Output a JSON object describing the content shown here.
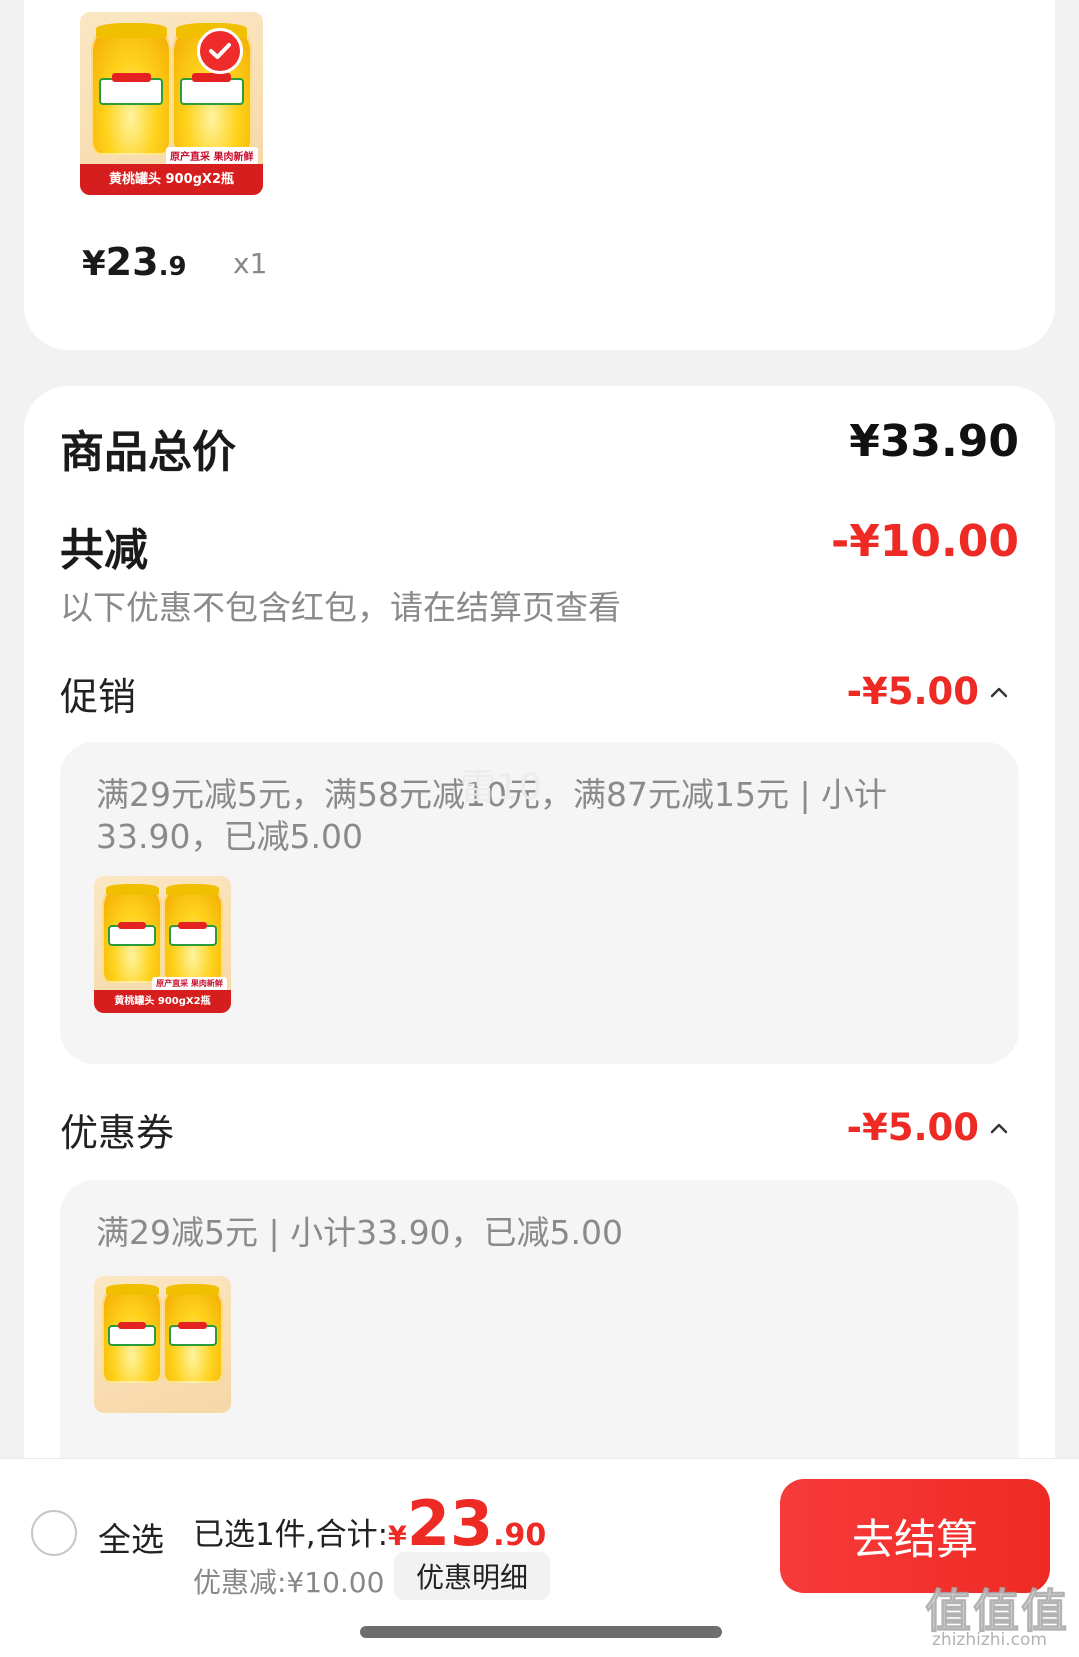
{
  "product": {
    "image_caption": "黄桃罐头 900gX2瓶",
    "image_badge": "原产直采 果肉新鲜",
    "price_yen": "¥",
    "price_int": "23",
    "price_dec": ".9",
    "qty": "x1",
    "check_icon": "check-icon"
  },
  "summary_card": {
    "total_label": "商品总价",
    "total_value": "¥33.90",
    "reduce_label": "共减",
    "reduce_value": "-¥10.00",
    "note": "以下优惠不包含红包，请在结算页查看",
    "promo": {
      "label": "促销",
      "value": "-¥5.00",
      "text": "满29元减5元，满58元减10元，满87元减15元 | 小计33.90，已减5.00"
    },
    "coupon": {
      "label": "优惠券",
      "value": "-¥5.00",
      "text": "满29减5元 | 小计33.90，已减5.00"
    },
    "watermark": "雷10"
  },
  "bottom_bar": {
    "select_all": "全选",
    "selected_text": "已选1件,合计:",
    "total_yen": "¥",
    "total_int": "23",
    "total_dec": ".90",
    "discount_text": "优惠减:¥10.00",
    "detail_button": "优惠明细",
    "checkout_button": "去结算"
  },
  "watermark": {
    "logo": "值值值",
    "url": "zhizhizhi.com"
  },
  "colors": {
    "accent_red": "#ee2a24",
    "background": "#f2f2f2",
    "muted_text": "#8a8a8a"
  }
}
